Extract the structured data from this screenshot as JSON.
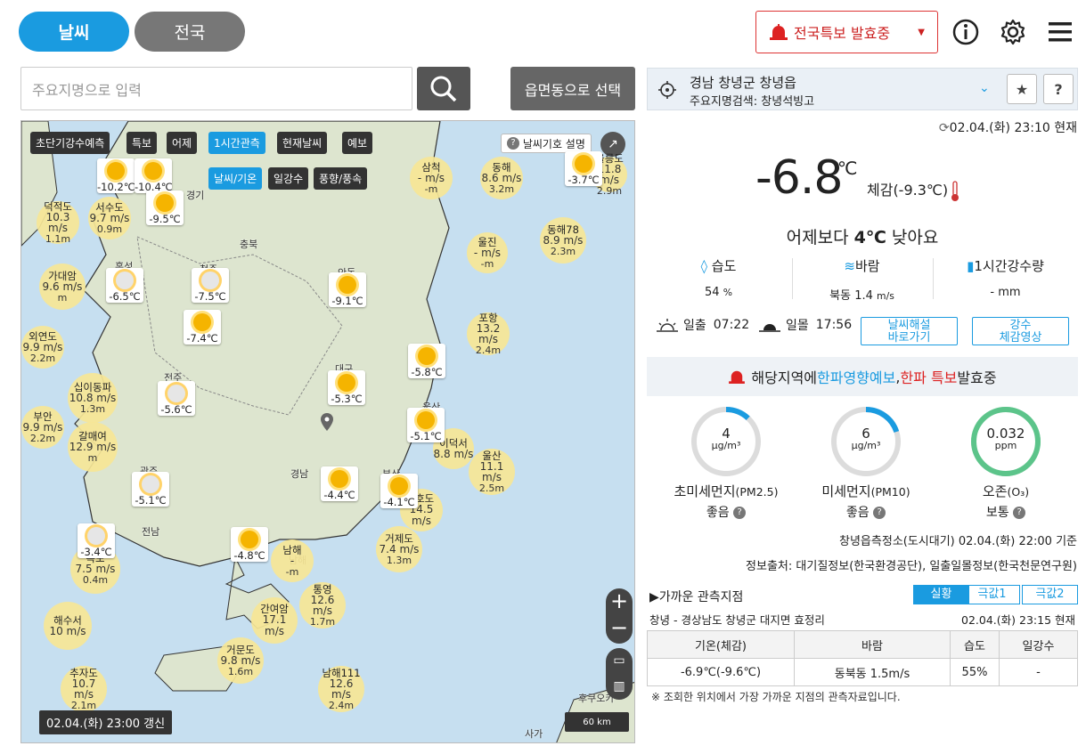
{
  "nav": {
    "weather_tab": "날씨",
    "national_tab": "전국"
  },
  "alert": {
    "label": "전국특보 발효중"
  },
  "search": {
    "placeholder": "주요지명으로 입력",
    "select_button": "읍면동으로 선택"
  },
  "map": {
    "toolbar": [
      "초단기강수예측",
      "특보",
      "어제",
      "1시간관측",
      "현재날씨",
      "예보"
    ],
    "subtoolbar": [
      "날씨/기온",
      "일강수",
      "풍향/풍속"
    ],
    "legend_button": "날씨기호 설명",
    "update_label": "02.04.(화) 23:00 갱신",
    "scale_label": "60 km",
    "places": [
      "경기",
      "충북",
      "홍성",
      "청주",
      "안동",
      "전주",
      "대구",
      "광주",
      "경남",
      "전남",
      "부산",
      "울산",
      "포항",
      "남해",
      "사가",
      "후쿠오카"
    ],
    "cards": [
      {
        "temp": "-10.2℃"
      },
      {
        "temp": "-10.4℃"
      },
      {
        "temp": "-9.5℃"
      },
      {
        "temp": "-3.7℃"
      },
      {
        "temp": "-6.5℃"
      },
      {
        "temp": "-7.5℃"
      },
      {
        "temp": "-7.4℃"
      },
      {
        "temp": "-9.1℃"
      },
      {
        "temp": "-5.8℃"
      },
      {
        "temp": "-5.6℃"
      },
      {
        "temp": "-5.3℃"
      },
      {
        "temp": "-5.1℃"
      },
      {
        "temp": "-5.1℃"
      },
      {
        "temp": "-4.4℃"
      },
      {
        "temp": "-4.1℃"
      },
      {
        "temp": "-3.4℃"
      },
      {
        "temp": "-4.8℃"
      }
    ],
    "stations": [
      {
        "name": "삼척",
        "speed": "-",
        "unit": "m/s",
        "extra": "-m"
      },
      {
        "name": "동해",
        "speed": "8.6",
        "unit": "m/s",
        "extra": "3.2m"
      },
      {
        "name": "울릉도",
        "speed": "11.8",
        "unit": "m/s",
        "extra": "2.9m"
      },
      {
        "name": "덕적도",
        "speed": "10.3",
        "unit": "m/s",
        "extra": "1.1m"
      },
      {
        "name": "서수도",
        "speed": "9.7",
        "unit": "m/s",
        "extra": "0.9m"
      },
      {
        "name": "울진",
        "speed": "-",
        "unit": "m/s",
        "extra": "-m"
      },
      {
        "name": "동해78",
        "speed": "8.9",
        "unit": "m/s",
        "extra": "2.3m"
      },
      {
        "name": "가대암",
        "speed": "9.6",
        "unit": "m/s",
        "extra": "m"
      },
      {
        "name": "포항",
        "speed": "13.2",
        "unit": "m/s",
        "extra": "2.4m"
      },
      {
        "name": "외연도",
        "speed": "9.9",
        "unit": "m/s",
        "extra": "2.2m"
      },
      {
        "name": "십이동파",
        "speed": "10.8",
        "unit": "m/s",
        "extra": "1.3m"
      },
      {
        "name": "부안",
        "speed": "9.9",
        "unit": "m/s",
        "extra": "2.2m"
      },
      {
        "name": "갈매여",
        "speed": "12.9",
        "unit": "m/s",
        "extra": "m"
      },
      {
        "name": "이덕서",
        "speed": "8.8",
        "unit": "m/s",
        "extra": ""
      },
      {
        "name": "울산",
        "speed": "11.1",
        "unit": "m/s",
        "extra": "2.5m"
      },
      {
        "name": "2호도",
        "speed": "14.5",
        "unit": "m/s",
        "extra": ""
      },
      {
        "name": "목포",
        "speed": "7.5",
        "unit": "m/s",
        "extra": "0.4m"
      },
      {
        "name": "거제도",
        "speed": "7.4",
        "unit": "m/s",
        "extra": "1.3m"
      },
      {
        "name": "남해",
        "speed": "-",
        "unit": "",
        "extra": "-m"
      },
      {
        "name": "통영",
        "speed": "12.6",
        "unit": "m/s",
        "extra": "1.7m"
      },
      {
        "name": "해수서",
        "speed": "10",
        "unit": "m/s",
        "extra": ""
      },
      {
        "name": "간여암",
        "speed": "17.1",
        "unit": "m/s",
        "extra": ""
      },
      {
        "name": "거문도",
        "speed": "9.8",
        "unit": "m/s",
        "extra": "1.6m"
      },
      {
        "name": "추자도",
        "speed": "10.7",
        "unit": "m/s",
        "extra": "2.1m"
      },
      {
        "name": "남해111",
        "speed": "12.6",
        "unit": "m/s",
        "extra": "2.4m"
      }
    ]
  },
  "location": {
    "name": "경남 창녕군 창녕읍",
    "search_hint": "주요지명검색: 창녕석빙고",
    "time": "02.04.(화) 23:10 현재"
  },
  "current": {
    "temp": "-6.8",
    "unit": "℃",
    "feels": "체감(-9.3℃)",
    "compare_prefix": "어제보다 ",
    "compare_bold": "4℃",
    "compare_suffix": " 낮아요",
    "humidity_label": "습도",
    "humidity_value": "54",
    "humidity_unit": "%",
    "wind_label": "바람",
    "wind_value": "북동 1.4",
    "wind_unit": "m/s",
    "rain_label": "1시간강수량",
    "rain_value": "- mm",
    "sunrise_label": "일출",
    "sunrise": "07:22",
    "sunset_label": "일몰",
    "sunset": "17:56",
    "btn_commentary": [
      "날씨해설",
      "바로가기"
    ],
    "btn_video": [
      "강수",
      "체감영상"
    ]
  },
  "warning": {
    "prefix": "해당지역에 ",
    "impact": "한파영향예보",
    "sep": ",",
    "cold": "한파 특보",
    "suffix": " 발효중"
  },
  "air": [
    {
      "value": "4",
      "unit": "μg/m³",
      "label": "초미세먼지",
      "sub": "(PM2.5)",
      "state": "좋음",
      "fraction": 0.12
    },
    {
      "value": "6",
      "unit": "μg/m³",
      "label": "미세먼지",
      "sub": "(PM10)",
      "state": "좋음",
      "fraction": 0.2
    },
    {
      "value": "0.032",
      "unit": "ppm",
      "label": "오존",
      "sub": "(O₃)",
      "state": "보통",
      "fraction": 1.0
    }
  ],
  "air_station": "창녕읍측정소(도시대기) 02.04.(화) 22:00 기준",
  "sources": "정보출처: 대기질정보(한국환경공단), 일출일몰정보(한국천문연구원)",
  "nearby": {
    "title": "▶가까운 관측지점",
    "tabs": [
      "실황",
      "극값1",
      "극값2"
    ],
    "station": "창녕 - 경상남도 창녕군 대지면 효정리",
    "time": "02.04.(화) 23:15 현재",
    "headers": [
      "기온(체감)",
      "바람",
      "습도",
      "일강수"
    ],
    "row": [
      "-6.9℃(-9.6℃)",
      "동북동 1.5m/s",
      "55%",
      "-"
    ],
    "note": "※ 조회한 위치에서 가장 가까운 지점의 관측자료입니다."
  },
  "colors": {
    "accent": "#1a9be0",
    "alert": "#cc2222",
    "gauge": "#1a9be0",
    "gauge_ozone": "#5cc48a"
  }
}
